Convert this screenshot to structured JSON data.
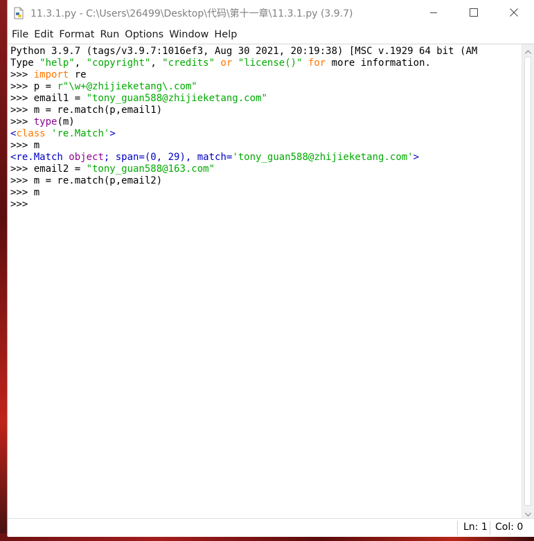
{
  "window": {
    "title": "11.3.1.py - C:\\Users\\26499\\Desktop\\代码\\第十一章\\11.3.1.py (3.9.7)",
    "title_color": "#808080"
  },
  "menubar": {
    "items": [
      {
        "label": "File"
      },
      {
        "label": "Edit"
      },
      {
        "label": "Format"
      },
      {
        "label": "Run"
      },
      {
        "label": "Options"
      },
      {
        "label": "Window"
      },
      {
        "label": "Help"
      }
    ]
  },
  "shell": {
    "colors": {
      "keyword": "#ff7700",
      "string": "#00aa00",
      "builtin": "#900090",
      "output": "#0000c0"
    },
    "lines": [
      [
        {
          "t": "Python 3.9.7 (tags/v3.9.7:1016ef3, Aug 30 2021, 20:19:38) [MSC v.1929 64 bit (AM",
          "k": "plain"
        }
      ],
      [
        {
          "t": "Type ",
          "k": "plain"
        },
        {
          "t": "\"help\"",
          "k": "str"
        },
        {
          "t": ", ",
          "k": "plain"
        },
        {
          "t": "\"copyright\"",
          "k": "str"
        },
        {
          "t": ", ",
          "k": "plain"
        },
        {
          "t": "\"credits\"",
          "k": "str"
        },
        {
          "t": " ",
          "k": "plain"
        },
        {
          "t": "or",
          "k": "kw"
        },
        {
          "t": " ",
          "k": "plain"
        },
        {
          "t": "\"license()\"",
          "k": "str"
        },
        {
          "t": " ",
          "k": "plain"
        },
        {
          "t": "for",
          "k": "kw"
        },
        {
          "t": " more information.",
          "k": "plain"
        }
      ],
      [
        {
          "t": ">>> ",
          "k": "prompt"
        },
        {
          "t": "import",
          "k": "kw"
        },
        {
          "t": " re",
          "k": "plain"
        }
      ],
      [
        {
          "t": ">>> ",
          "k": "prompt"
        },
        {
          "t": "p = ",
          "k": "plain"
        },
        {
          "t": "r\"\\w+@zhijieketang\\.com\"",
          "k": "str"
        }
      ],
      [
        {
          "t": ">>> ",
          "k": "prompt"
        },
        {
          "t": "email1 = ",
          "k": "plain"
        },
        {
          "t": "\"tony_guan588@zhijieketang.com\"",
          "k": "str"
        }
      ],
      [
        {
          "t": ">>> ",
          "k": "prompt"
        },
        {
          "t": "m = re.match(p,email1)",
          "k": "plain"
        }
      ],
      [
        {
          "t": ">>> ",
          "k": "prompt"
        },
        {
          "t": "type",
          "k": "bi"
        },
        {
          "t": "(m)",
          "k": "plain"
        }
      ],
      [
        {
          "t": "<",
          "k": "out"
        },
        {
          "t": "class",
          "k": "kw"
        },
        {
          "t": " ",
          "k": "out"
        },
        {
          "t": "'re.Match'",
          "k": "str"
        },
        {
          "t": ">",
          "k": "out"
        }
      ],
      [
        {
          "t": ">>> ",
          "k": "prompt"
        },
        {
          "t": "m",
          "k": "plain"
        }
      ],
      [
        {
          "t": "<re.Match ",
          "k": "out"
        },
        {
          "t": "object",
          "k": "bi"
        },
        {
          "t": "; span=(0, 29), match=",
          "k": "out"
        },
        {
          "t": "'tony_guan588@zhijieketang.com'",
          "k": "str"
        },
        {
          "t": ">",
          "k": "out"
        }
      ],
      [
        {
          "t": ">>> ",
          "k": "prompt"
        },
        {
          "t": "email2 = ",
          "k": "plain"
        },
        {
          "t": "\"tony_guan588@163.com\"",
          "k": "str"
        }
      ],
      [
        {
          "t": ">>> ",
          "k": "prompt"
        },
        {
          "t": "m = re.match(p,email2)",
          "k": "plain"
        }
      ],
      [
        {
          "t": ">>> ",
          "k": "prompt"
        },
        {
          "t": "m",
          "k": "plain"
        }
      ],
      [
        {
          "t": ">>> ",
          "k": "prompt"
        }
      ]
    ]
  },
  "statusbar": {
    "ln": "Ln: 1",
    "col": "Col: 0"
  },
  "icons": {
    "app": "python-file-icon",
    "minimize": "minimize-icon",
    "maximize": "maximize-icon",
    "close": "close-icon",
    "scroll_up": "chevron-up-icon",
    "scroll_down": "chevron-down-icon"
  }
}
